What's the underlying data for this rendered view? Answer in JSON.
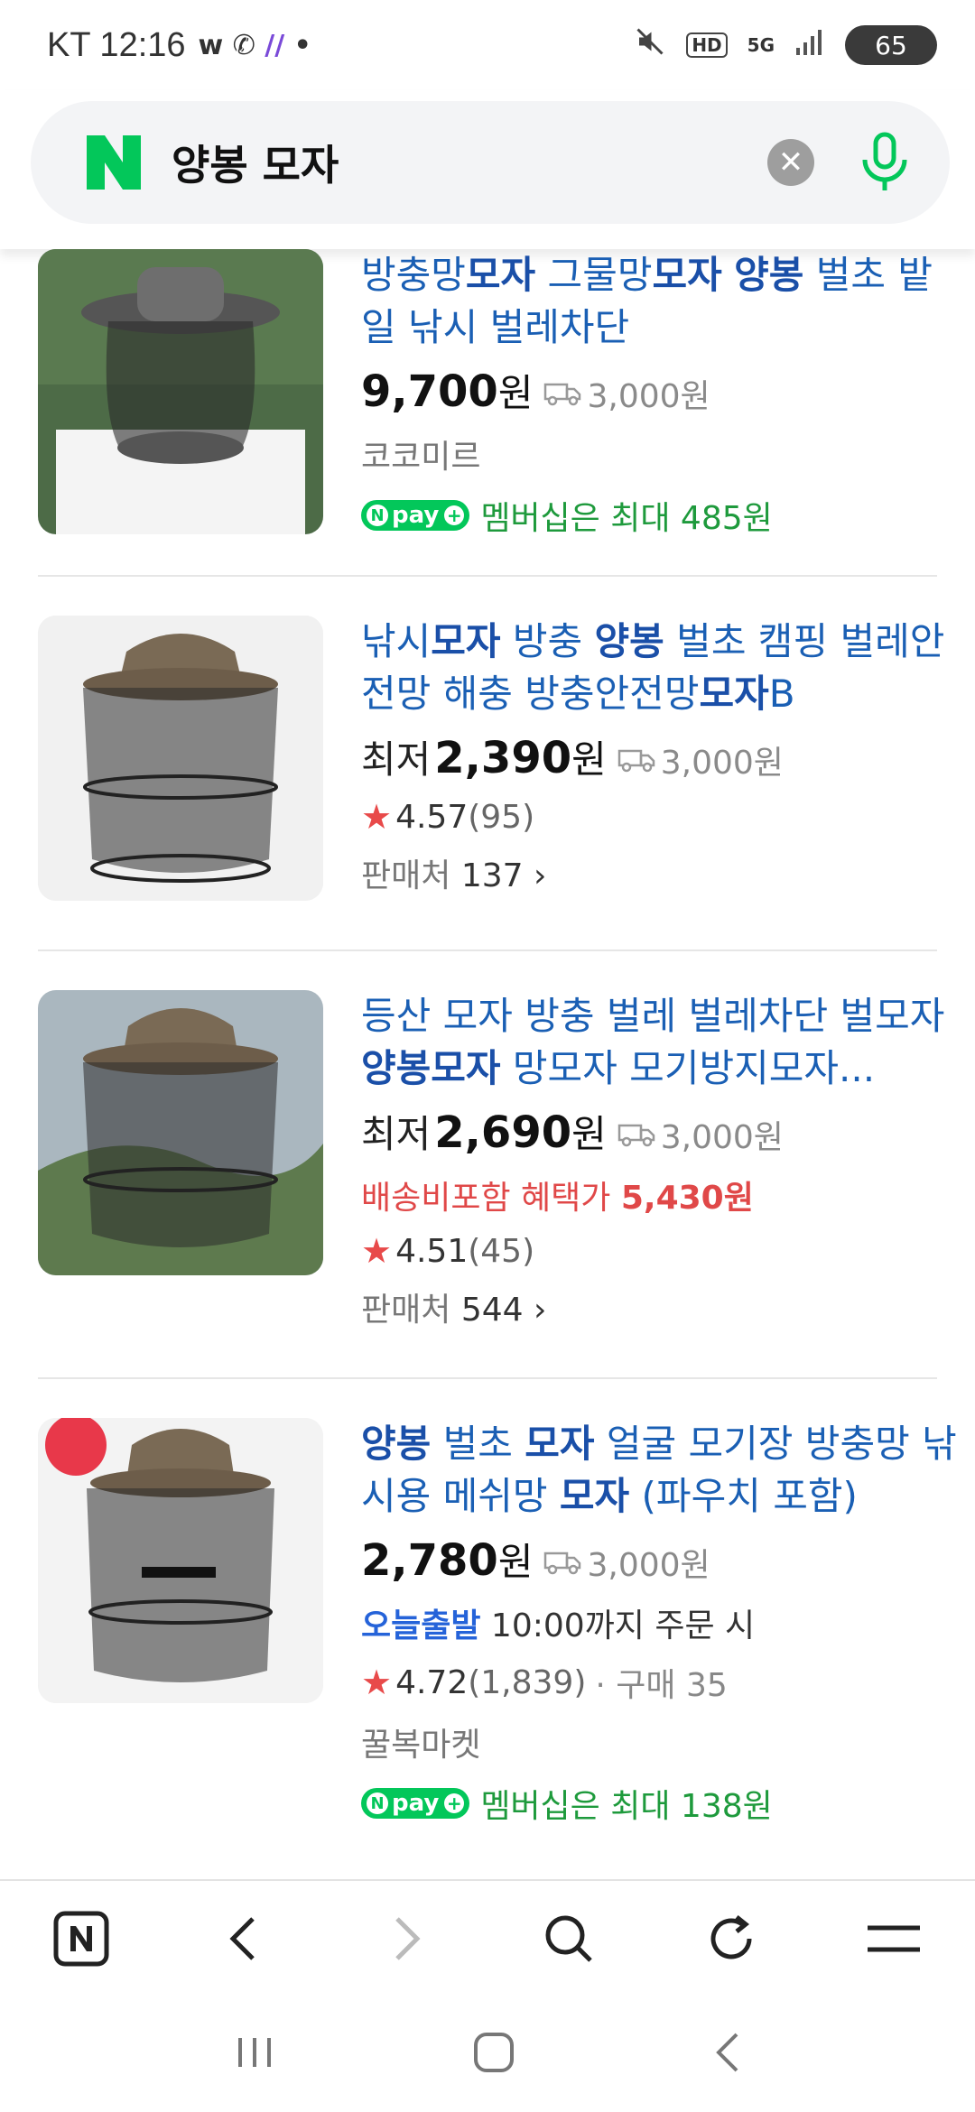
{
  "status_bar": {
    "carrier_time": "KT 12:16",
    "battery": "65"
  },
  "search": {
    "query": "양봉 모자"
  },
  "products": [
    {
      "title_parts": [
        {
          "t": "방충망",
          "b": false
        },
        {
          "t": "모자",
          "b": true
        },
        {
          "t": " 그물망",
          "b": false
        },
        {
          "t": "모자",
          "b": true
        },
        {
          "t": " ",
          "b": false
        },
        {
          "t": "양봉",
          "b": true
        },
        {
          "t": " 벌초 밭일 낚시 벌레차단",
          "b": false
        }
      ],
      "price_prefix": "",
      "price": "9,700",
      "won": "원",
      "shipping": "3,000원",
      "seller": "코코미르",
      "npay_text": "멤버십은 최대 485원"
    },
    {
      "title_parts": [
        {
          "t": "낚시",
          "b": false
        },
        {
          "t": "모자",
          "b": true
        },
        {
          "t": " 방충 ",
          "b": false
        },
        {
          "t": "양봉",
          "b": true
        },
        {
          "t": " 벌초 캠핑 벌레안전망 해충 방충안전망",
          "b": false
        },
        {
          "t": "모자",
          "b": true
        },
        {
          "t": "B",
          "b": false
        }
      ],
      "price_prefix": "최저",
      "price": "2,390",
      "won": "원",
      "shipping": "3,000원",
      "rating": "4.57",
      "reviews": "(95)",
      "sellers_label": "판매처",
      "sellers_count": "137"
    },
    {
      "title_parts": [
        {
          "t": "등산 모자 방충 벌레 벌레차단 벌모자 ",
          "b": false
        },
        {
          "t": "양봉모자",
          "b": true
        },
        {
          "t": " 망모자 모기방지모자...",
          "b": false
        }
      ],
      "price_prefix": "최저",
      "price": "2,690",
      "won": "원",
      "shipping": "3,000원",
      "benefit_label": "배송비포함 혜택가 ",
      "benefit_price": "5,430원",
      "rating": "4.51",
      "reviews": "(45)",
      "sellers_label": "판매처",
      "sellers_count": "544"
    },
    {
      "title_parts": [
        {
          "t": "양봉",
          "b": true
        },
        {
          "t": " 벌초 ",
          "b": false
        },
        {
          "t": "모자",
          "b": true
        },
        {
          "t": " 얼굴 모기장 방충망 낚시용 메쉬망 ",
          "b": false
        },
        {
          "t": "모자",
          "b": true
        },
        {
          "t": " (파우치 포함)",
          "b": false
        }
      ],
      "price_prefix": "",
      "price": "2,780",
      "won": "원",
      "shipping": "3,000원",
      "delivery_badge": "오늘출발",
      "delivery_text": " 10:00까지 주문 시",
      "rating": "4.72",
      "reviews": "(1,839)",
      "purchases": "· 구매 35",
      "seller": "꿀복마켓",
      "npay_text": "멤버십은 최대 138원"
    }
  ],
  "colors": {
    "title_blue": "#1a5fb4",
    "naver_green": "#03c75a",
    "star_red": "#e84a4a",
    "benefit_red": "#e04848"
  },
  "icons": {
    "npay": "npay-badge-icon",
    "truck": "truck-icon",
    "star": "star-icon"
  }
}
